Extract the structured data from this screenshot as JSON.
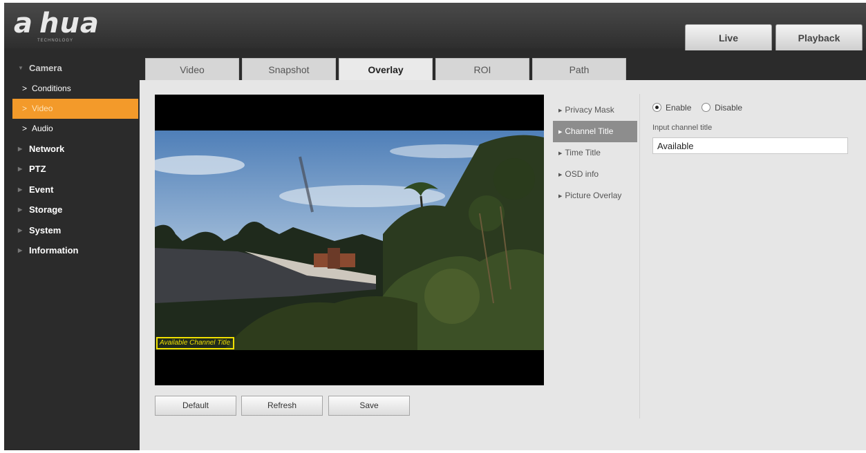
{
  "header": {
    "logo": "a hua",
    "logo_sub": "TECHNOLOGY",
    "tabs": [
      "Live",
      "Playback"
    ]
  },
  "sidebar": {
    "sections": [
      {
        "label": "Camera",
        "expanded": true
      },
      {
        "label": "Network"
      },
      {
        "label": "PTZ"
      },
      {
        "label": "Event"
      },
      {
        "label": "Storage"
      },
      {
        "label": "System"
      },
      {
        "label": "Information"
      }
    ],
    "camera_children": [
      "Conditions",
      "Video",
      "Audio"
    ],
    "active_child": "Video"
  },
  "subtabs": [
    "Video",
    "Snapshot",
    "Overlay",
    "ROI",
    "Path"
  ],
  "active_subtab": "Overlay",
  "preview": {
    "channel_title_overlay": "Available Channel Title"
  },
  "buttons": {
    "default": "Default",
    "refresh": "Refresh",
    "save": "Save"
  },
  "overlay_menu": [
    "Privacy Mask",
    "Channel Title",
    "Time Title",
    "OSD info",
    "Picture Overlay"
  ],
  "active_overlay_item": "Channel Title",
  "options": {
    "enable": "Enable",
    "disable": "Disable",
    "selected": "Enable",
    "input_label": "Input channel title",
    "input_value": "Available"
  },
  "colors": {
    "accent": "#f39a2a",
    "sidebar_bg": "#2b2b2b",
    "content_bg": "#e6e6e6",
    "overlay_box": "#f0e000",
    "active_menu": "#8d8d8d"
  }
}
